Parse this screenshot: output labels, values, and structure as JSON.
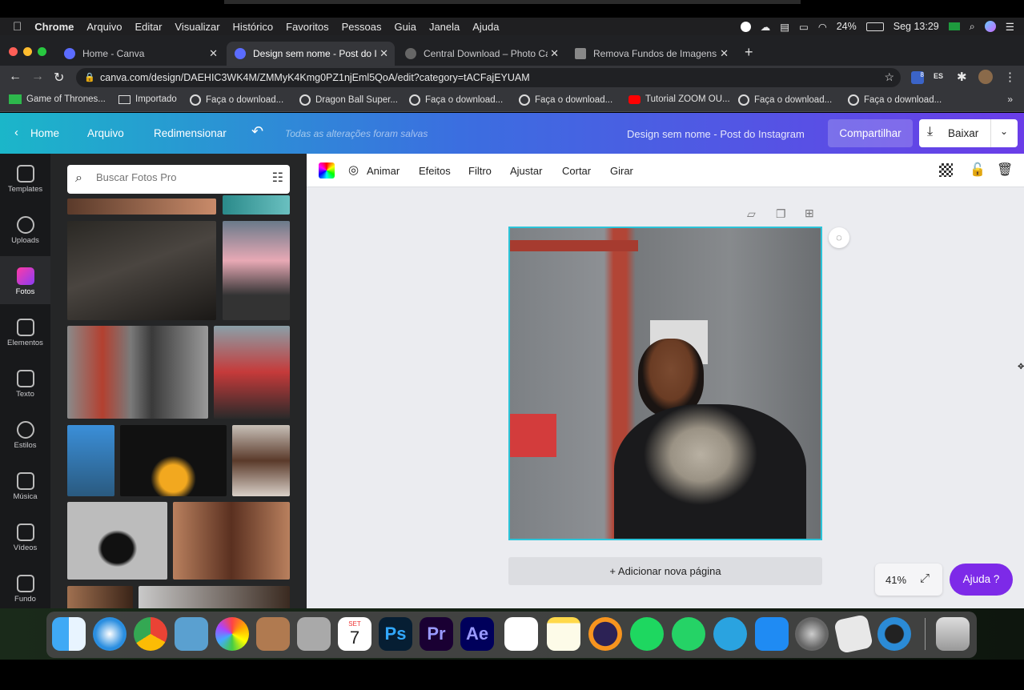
{
  "mac_menu": {
    "app": "Chrome",
    "items": [
      "Arquivo",
      "Editar",
      "Visualizar",
      "Histórico",
      "Favoritos",
      "Pessoas",
      "Guia",
      "Janela",
      "Ajuda"
    ],
    "battery": "24%",
    "clock": "Seg 13:29"
  },
  "tabs": [
    {
      "title": "Home - Canva"
    },
    {
      "title": "Design sem nome - Post do Ins"
    },
    {
      "title": "Central Download – Photo Can"
    },
    {
      "title": "Remova Fundos de Imagens –"
    }
  ],
  "address": {
    "url": "canva.com/design/DAEHIC3WK4M/ZMMyK4Kmg0PZ1njEml5QoA/edit?category=tACFajEYUAM",
    "ext_badge": "8",
    "ext_es": "ES"
  },
  "bookmarks": [
    "Game of Thrones...",
    "Importado",
    "Faça o download...",
    "Dragon Ball Super...",
    "Faça o download...",
    "Faça o download...",
    "Tutorial ZOOM OU...",
    "Faça o download...",
    "Faça o download..."
  ],
  "canva_header": {
    "home": "Home",
    "file": "Arquivo",
    "resize": "Redimensionar",
    "saved": "Todas as alterações foram salvas",
    "design_name": "Design sem nome - Post do Instagram",
    "share": "Compartilhar",
    "download": "Baixar"
  },
  "rail": [
    {
      "label": "Templates",
      "icon": "templates-icon"
    },
    {
      "label": "Uploads",
      "icon": "upload-icon"
    },
    {
      "label": "Fotos",
      "icon": "photos-icon"
    },
    {
      "label": "Elementos",
      "icon": "elements-icon"
    },
    {
      "label": "Texto",
      "icon": "text-icon"
    },
    {
      "label": "Estilos",
      "icon": "styles-icon"
    },
    {
      "label": "Música",
      "icon": "music-icon"
    },
    {
      "label": "Vídeos",
      "icon": "video-icon"
    },
    {
      "label": "Fundo",
      "icon": "background-icon"
    }
  ],
  "search": {
    "placeholder": "Buscar Fotos Pro"
  },
  "toolbar": {
    "animate": "Animar",
    "effects": "Efeitos",
    "filter": "Filtro",
    "adjust": "Ajustar",
    "crop": "Cortar",
    "rotate": "Girar"
  },
  "canvas": {
    "add_page": "+ Adicionar nova página",
    "zoom": "41%",
    "help": "Ajuda  ?"
  },
  "dock": [
    {
      "label": "",
      "name": "finder"
    },
    {
      "label": "",
      "name": "safari"
    },
    {
      "label": "",
      "name": "chrome"
    },
    {
      "label": "",
      "name": "mail"
    },
    {
      "label": "",
      "name": "photos"
    },
    {
      "label": "",
      "name": "contacts"
    },
    {
      "label": "",
      "name": "calculator"
    },
    {
      "label": "7",
      "name": "calendar"
    },
    {
      "label": "Ps",
      "name": "photoshop"
    },
    {
      "label": "Pr",
      "name": "premiere"
    },
    {
      "label": "Ae",
      "name": "after-effects"
    },
    {
      "label": "",
      "name": "reminders"
    },
    {
      "label": "",
      "name": "notes"
    },
    {
      "label": "",
      "name": "eclipse"
    },
    {
      "label": "",
      "name": "spotify"
    },
    {
      "label": "",
      "name": "whatsapp"
    },
    {
      "label": "",
      "name": "telegram"
    },
    {
      "label": "",
      "name": "app-store"
    },
    {
      "label": "",
      "name": "system-preferences"
    },
    {
      "label": "",
      "name": "roblox"
    },
    {
      "label": "",
      "name": "quicktime"
    },
    {
      "label": "",
      "name": "trash"
    }
  ],
  "calendar_month": "SET"
}
